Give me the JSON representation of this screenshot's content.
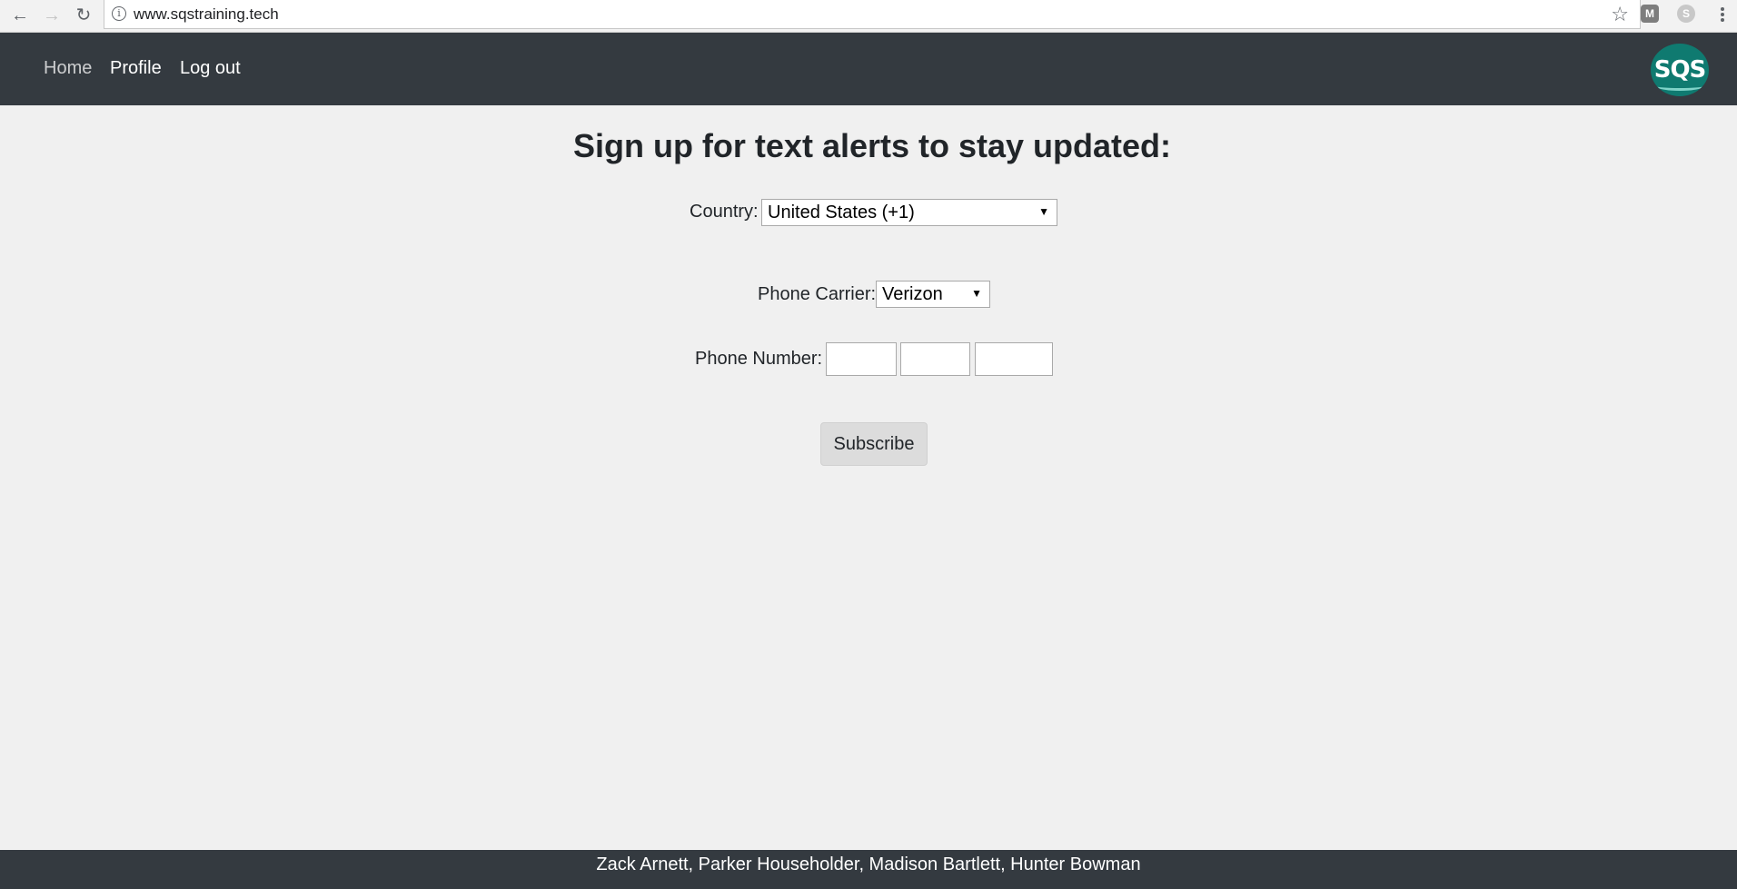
{
  "browser": {
    "url": "www.sqstraining.tech",
    "info_icon": "info-icon",
    "back_icon": "←",
    "forward_icon": "→",
    "reload_icon": "↻",
    "star_icon": "☆",
    "ext1_label": "M",
    "ext2_label": "S"
  },
  "navbar": {
    "items": [
      {
        "label": "Home"
      },
      {
        "label": "Profile"
      },
      {
        "label": "Log out"
      }
    ],
    "logo_text": "SQS",
    "background": "#343a40"
  },
  "main": {
    "title": "Sign up for text alerts to stay updated:",
    "country": {
      "label": "Country:",
      "value": "United States (+1)"
    },
    "carrier": {
      "label": "Phone Carrier:",
      "value": "Verizon"
    },
    "phone": {
      "label": "Phone Number:",
      "parts": [
        "",
        "",
        ""
      ]
    },
    "subscribe_label": "Subscribe"
  },
  "footer": {
    "text": "Zack Arnett, Parker Householder, Madison Bartlett, Hunter Bowman"
  },
  "colors": {
    "accent_logo": "#0f7a70",
    "page_background": "#f0f0f0"
  }
}
